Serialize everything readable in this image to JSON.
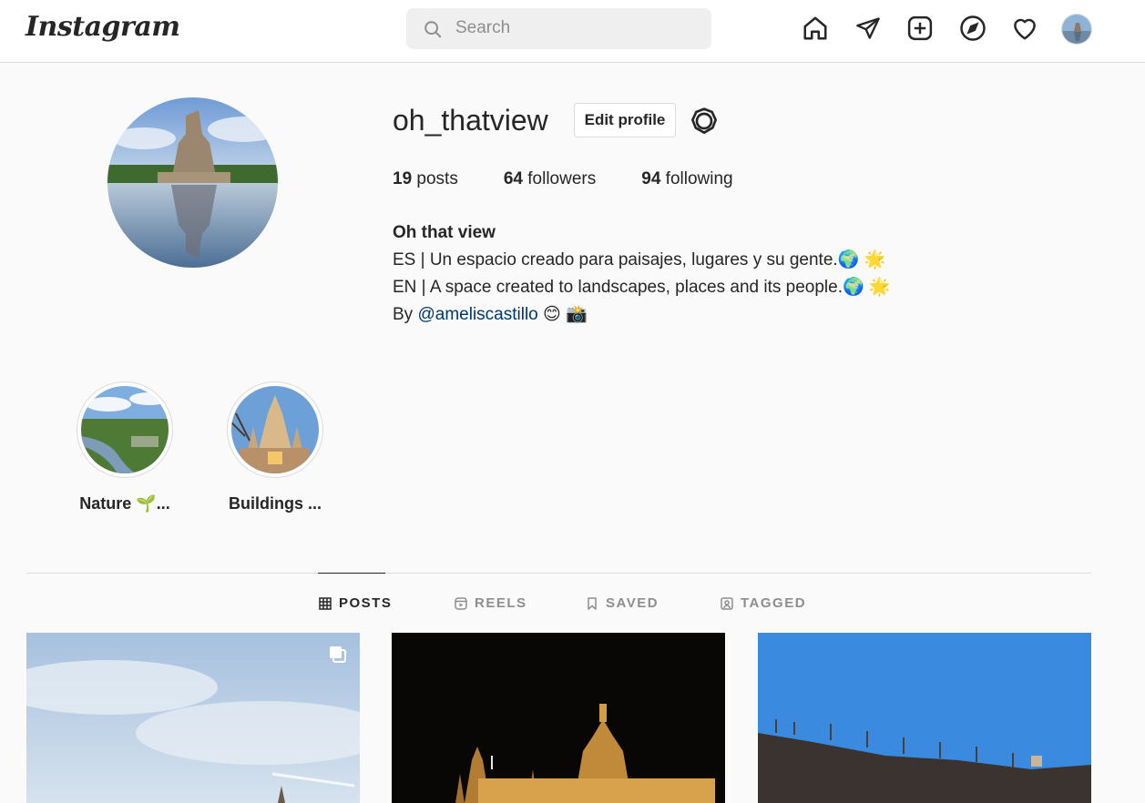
{
  "app": {
    "logo_text": "Instagram"
  },
  "search": {
    "placeholder": "Search",
    "value": ""
  },
  "nav_icons": [
    "home-icon",
    "direct-icon",
    "new-post-icon",
    "explore-icon",
    "activity-heart-icon"
  ],
  "profile": {
    "username": "oh_thatview",
    "edit_button": "Edit profile",
    "stats": {
      "posts_count": "19",
      "posts_label": "posts",
      "followers_count": "64",
      "followers_label": "followers",
      "following_count": "94",
      "following_label": "following"
    },
    "bio": {
      "name": "Oh that view",
      "line1": "ES | Un espacio creado para paisajes, lugares y su gente.🌍 🌟",
      "line2": "EN | A space created to landscapes, places and its people.🌍 🌟",
      "line3_prefix": "By",
      "mention": "@ameliscastillo",
      "line3_suffix": "😊 📸"
    }
  },
  "highlights": [
    {
      "label": "Nature 🌱..."
    },
    {
      "label": "Buildings ..."
    }
  ],
  "tabs": [
    {
      "label": "POSTS",
      "active": true
    },
    {
      "label": "REELS",
      "active": false
    },
    {
      "label": "SAVED",
      "active": false
    },
    {
      "label": "TAGGED",
      "active": false
    }
  ]
}
